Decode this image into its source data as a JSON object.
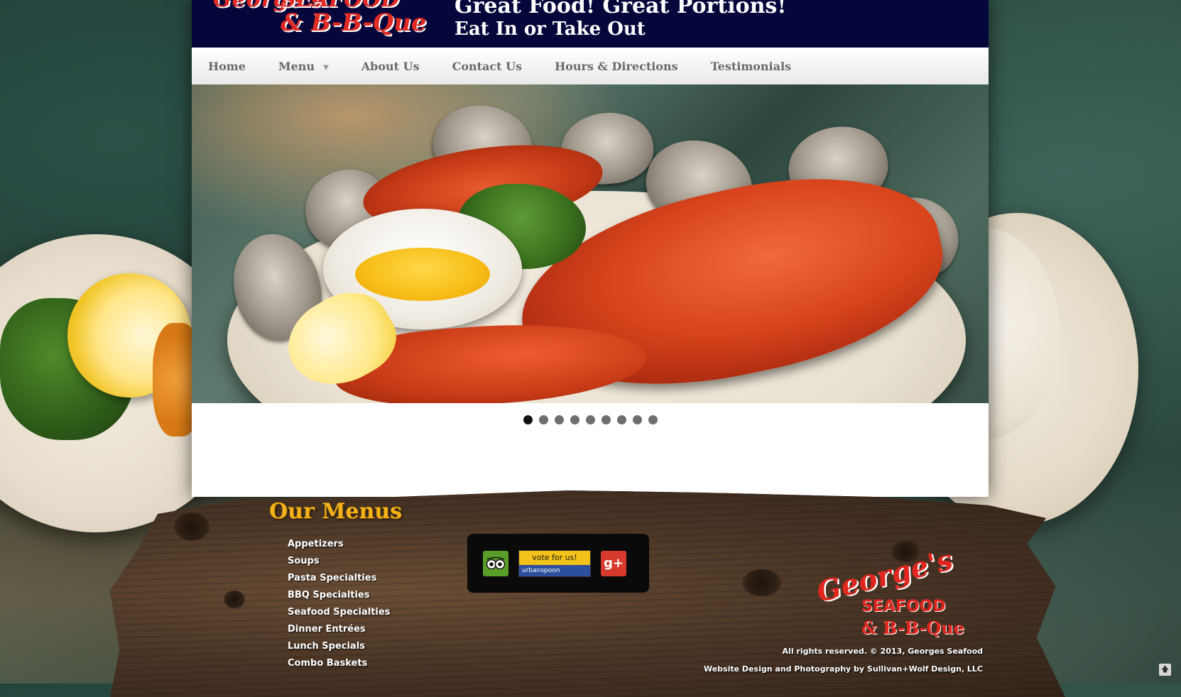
{
  "header": {
    "logo_lines": [
      "George's",
      "SEAFOOD",
      "& B-B-Que"
    ],
    "tagline_1": "Great Food! Great Portions!",
    "tagline_2": "Eat In or Take Out",
    "background": "#05063a"
  },
  "nav": {
    "items": [
      {
        "label": "Home"
      },
      {
        "label": "Menu"
      },
      {
        "label": "About Us"
      },
      {
        "label": "Contact Us"
      },
      {
        "label": "Hours & Directions"
      },
      {
        "label": "Testimonials"
      }
    ]
  },
  "slideshow": {
    "dot_count": 9,
    "active_index": 0
  },
  "footer": {
    "menus_heading": "Our Menus",
    "menu_links": [
      "Appetizers",
      "Soups",
      "Pasta Specialties",
      "BBQ Specialties",
      "Seafood Specialties",
      "Dinner Entrées",
      "Lunch Specials",
      "Combo Baskets"
    ],
    "social": {
      "urbanspoon_top": "vote for us!",
      "urbanspoon_bottom": "urbanspoon",
      "gplus_label": "g+"
    },
    "logo": {
      "georges": "George's",
      "seafood": "SEAFOOD",
      "bbq": "& B-B-Que"
    },
    "copyright": "All rights reserved. © 2013, Georges Seafood",
    "credits": "Website Design and Photography by Sullivan+Wolf Design, LLC",
    "heading_color": "#f3b21b",
    "logo_color": "#e1261f"
  }
}
